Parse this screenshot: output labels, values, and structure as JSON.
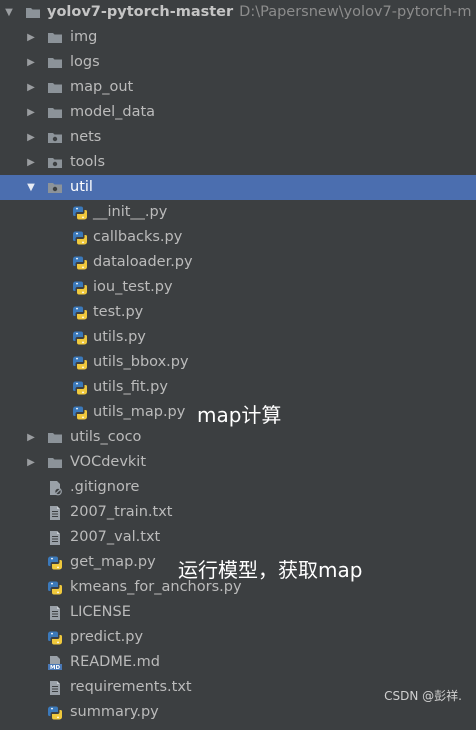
{
  "project": {
    "root": {
      "label": "yolov7-pytorch-master",
      "path": "D:\\Papersnew\\yolov7-pytorch-m"
    },
    "items": [
      {
        "label": "img",
        "kind": "folder",
        "depth": 1,
        "state": "collapsed"
      },
      {
        "label": "logs",
        "kind": "folder",
        "depth": 1,
        "state": "collapsed"
      },
      {
        "label": "map_out",
        "kind": "folder",
        "depth": 1,
        "state": "collapsed"
      },
      {
        "label": "model_data",
        "kind": "folder",
        "depth": 1,
        "state": "collapsed"
      },
      {
        "label": "nets",
        "kind": "package",
        "depth": 1,
        "state": "collapsed"
      },
      {
        "label": "tools",
        "kind": "package",
        "depth": 1,
        "state": "collapsed"
      },
      {
        "label": "util",
        "kind": "package",
        "depth": 1,
        "state": "expanded",
        "selected": true
      },
      {
        "label": "__init__.py",
        "kind": "python",
        "depth": 2
      },
      {
        "label": "callbacks.py",
        "kind": "python",
        "depth": 2
      },
      {
        "label": "dataloader.py",
        "kind": "python",
        "depth": 2
      },
      {
        "label": "iou_test.py",
        "kind": "python",
        "depth": 2
      },
      {
        "label": "test.py",
        "kind": "python",
        "depth": 2
      },
      {
        "label": "utils.py",
        "kind": "python",
        "depth": 2
      },
      {
        "label": "utils_bbox.py",
        "kind": "python",
        "depth": 2
      },
      {
        "label": "utils_fit.py",
        "kind": "python",
        "depth": 2
      },
      {
        "label": "utils_map.py",
        "kind": "python",
        "depth": 2
      },
      {
        "label": "utils_coco",
        "kind": "folder",
        "depth": 1,
        "state": "collapsed"
      },
      {
        "label": "VOCdevkit",
        "kind": "folder",
        "depth": 1,
        "state": "collapsed"
      },
      {
        "label": ".gitignore",
        "kind": "ignore",
        "depth": 1
      },
      {
        "label": "2007_train.txt",
        "kind": "text",
        "depth": 1
      },
      {
        "label": "2007_val.txt",
        "kind": "text",
        "depth": 1
      },
      {
        "label": "get_map.py",
        "kind": "python",
        "depth": 1
      },
      {
        "label": "kmeans_for_anchors.py",
        "kind": "python",
        "depth": 1
      },
      {
        "label": "LICENSE",
        "kind": "text",
        "depth": 1
      },
      {
        "label": "predict.py",
        "kind": "python",
        "depth": 1
      },
      {
        "label": "README.md",
        "kind": "markdown",
        "depth": 1
      },
      {
        "label": "requirements.txt",
        "kind": "text",
        "depth": 1
      },
      {
        "label": "summary.py",
        "kind": "python",
        "depth": 1
      }
    ]
  },
  "annotations": {
    "utils_map": "map计算",
    "get_map": "运行模型，获取map"
  },
  "watermark": "CSDN @彭祥.",
  "colors": {
    "background": "#3c3f41",
    "selection": "#4b6eaf",
    "text": "#bbbbbb",
    "folder": "#8c9399",
    "python_blue": "#3b79ba",
    "python_yellow": "#f0c93c"
  }
}
